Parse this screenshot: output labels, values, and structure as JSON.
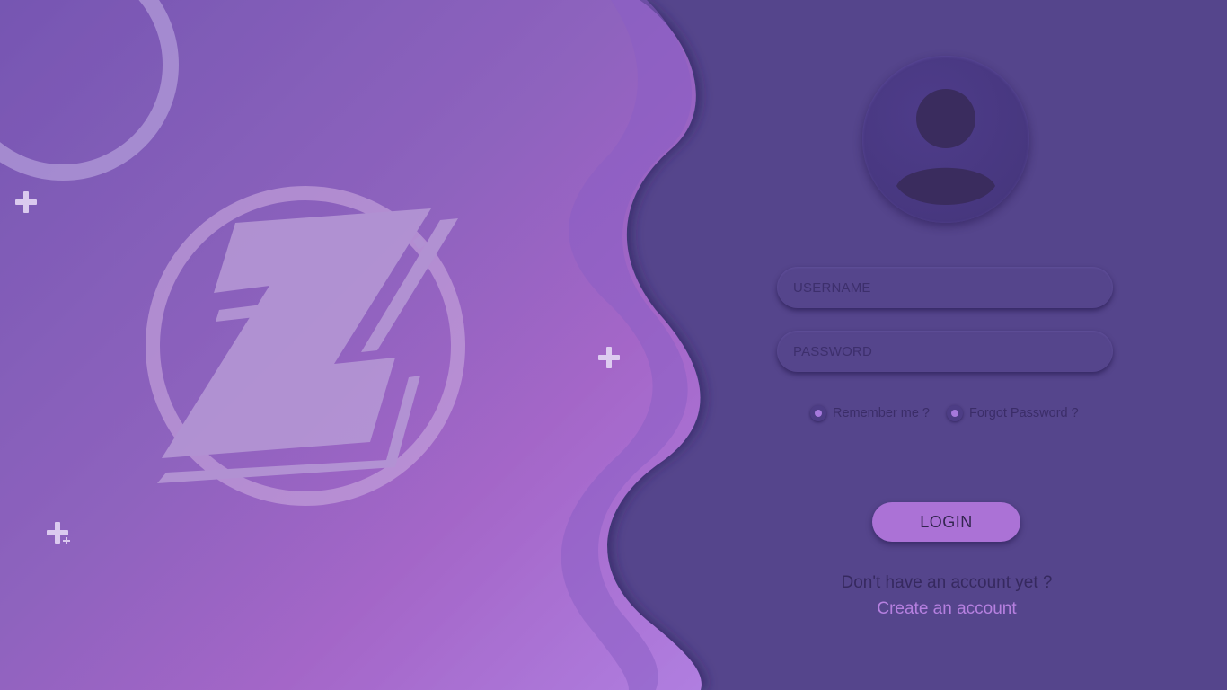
{
  "login_panel": {
    "username_placeholder": "USERNAME",
    "password_placeholder": "PASSWORD",
    "remember_label": "Remember me ?",
    "forgot_label": "Forgot Password ?",
    "login_label": "LOGIN",
    "signup_prompt": "Don't have an account yet ?",
    "create_account_label": "Create an account"
  },
  "icons": {
    "avatar": "user-silhouette-icon",
    "logo": "z-logo-icon",
    "sparkle": "plus-sparkle-icon"
  },
  "colors": {
    "panel_background": "#55458c",
    "accent": "#ab72d6",
    "link": "#b680e0",
    "gradient_start": "#7656b2",
    "gradient_end": "#b07ee0"
  }
}
